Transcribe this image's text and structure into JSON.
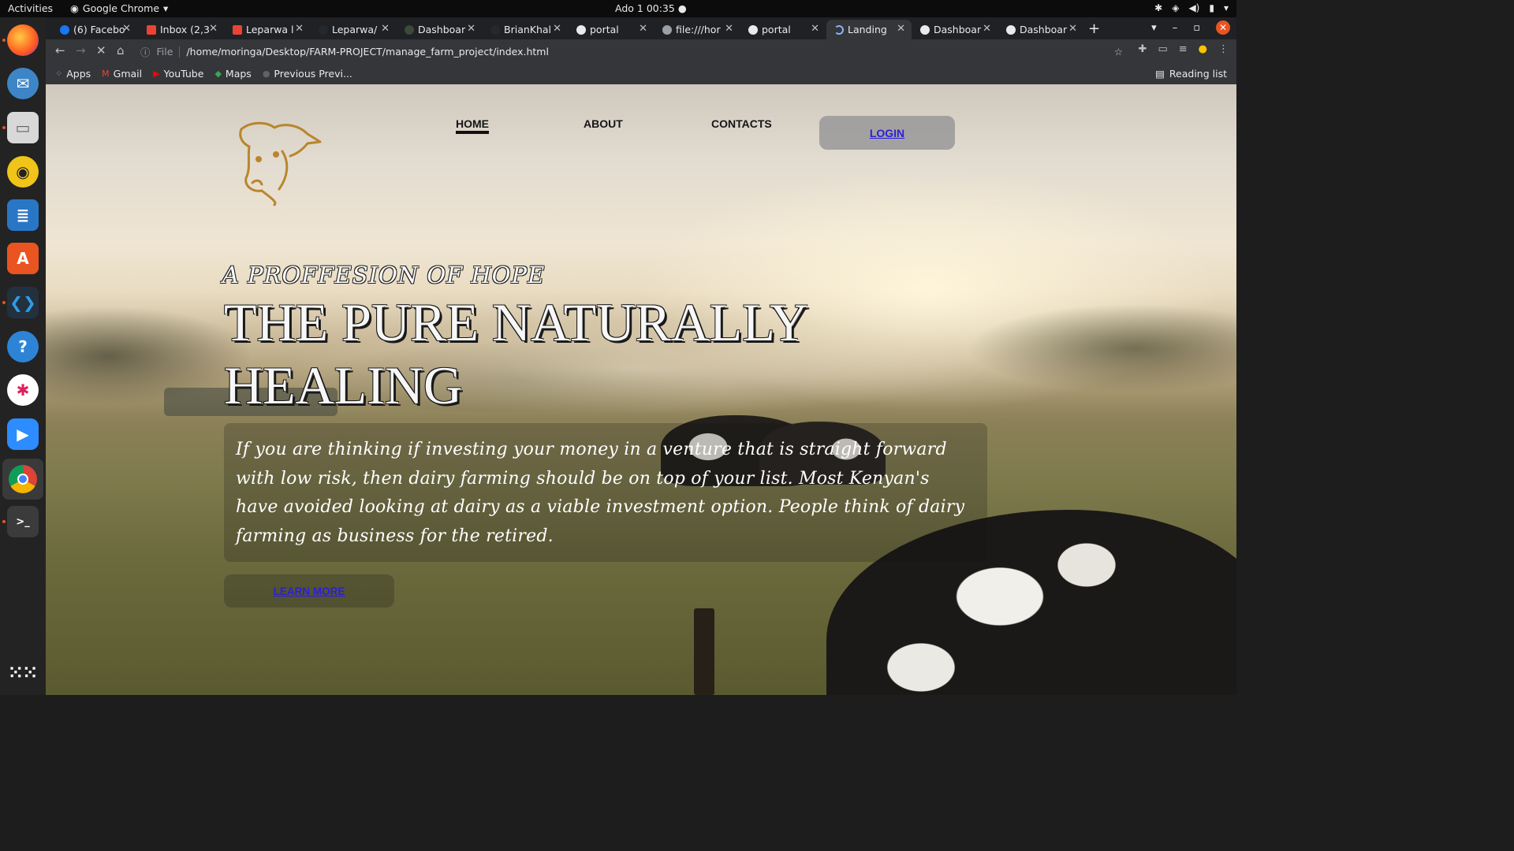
{
  "system_bar": {
    "activities": "Activities",
    "app_name": "Google Chrome",
    "clock": "Ado 1  00:35"
  },
  "browser": {
    "tabs": [
      {
        "label": "(6) Facebo",
        "favicon_color": "#1877f2"
      },
      {
        "label": "Inbox (2,3",
        "favicon_color": "#ea4335"
      },
      {
        "label": "Leparwa l",
        "favicon_color": "#ea4335"
      },
      {
        "label": "Leparwa/",
        "favicon_color": "#24292e"
      },
      {
        "label": "Dashboar",
        "favicon_color": "#3a4a3a"
      },
      {
        "label": "BrianKhal",
        "favicon_color": "#24292e"
      },
      {
        "label": "portal",
        "favicon_color": "#e8eaed"
      },
      {
        "label": "file:///hor",
        "favicon_color": "#9aa0a6"
      },
      {
        "label": "portal",
        "favicon_color": "#e8eaed"
      },
      {
        "label": "Landing",
        "favicon_color": "#8ab4f8",
        "active": true
      },
      {
        "label": "Dashboar",
        "favicon_color": "#e8eaed"
      },
      {
        "label": "Dashboar",
        "favicon_color": "#e8eaed"
      }
    ],
    "scheme": "File",
    "url": "/home/moringa/Desktop/FARM-PROJECT/manage_farm_project/index.html",
    "bookmarks": [
      "Apps",
      "Gmail",
      "YouTube",
      "Maps",
      "Previous Previ..."
    ],
    "reading_list": "Reading list"
  },
  "page": {
    "nav": {
      "home": "HOME",
      "about": "ABOUT",
      "contacts": "CONTACTS",
      "login": "LOGIN"
    },
    "tagline": "A PROFFESION OF HOPE",
    "headline": "THE PURE NATURALLY HEALING",
    "body": "If you are thinking if investing your money in a venture that is straight forward with low risk, then dairy farming should be on top of your list. Most Kenyan's have avoided looking at dairy as a viable investment option. People think of dairy farming as business for the retired.",
    "cta": "LEARN MORE",
    "colors": {
      "link": "#2b1fd9",
      "logo": "#b8862c"
    }
  }
}
